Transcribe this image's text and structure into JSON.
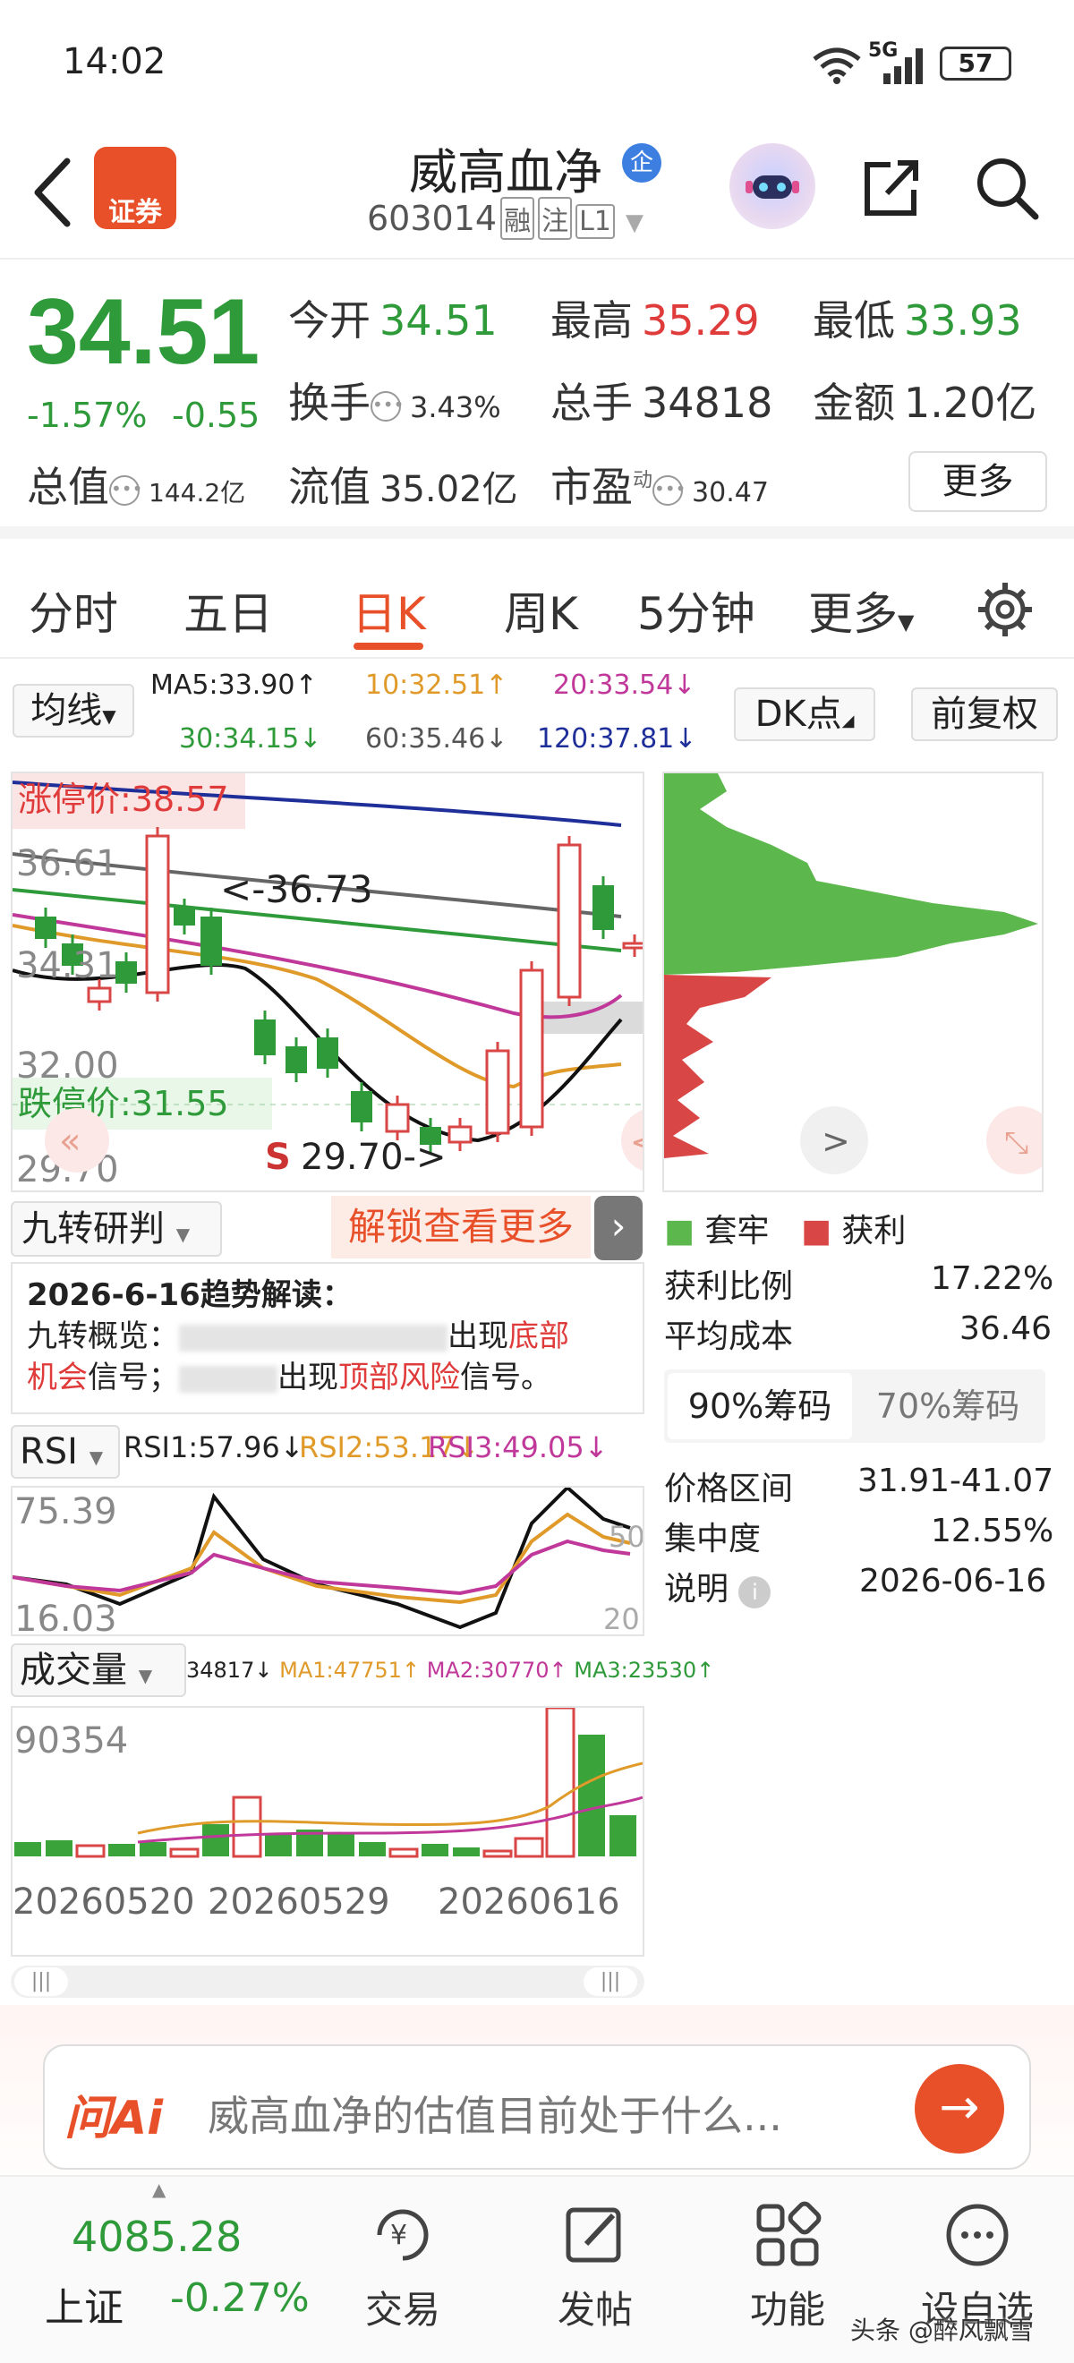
{
  "status": {
    "time": "14:02",
    "battery": "57",
    "network": "5G"
  },
  "header": {
    "app_logo": "证券",
    "name": "威高血净",
    "badge": "企",
    "code": "603014",
    "tags": [
      "融",
      "注",
      "L1"
    ]
  },
  "quote": {
    "price": "34.51",
    "pct": "-1.57%",
    "chg": "-0.55",
    "open_label": "今开",
    "open": "34.51",
    "high_label": "最高",
    "high": "35.29",
    "low_label": "最低",
    "low": "33.93",
    "turnover_label": "换手",
    "turnover": "3.43%",
    "volume_label": "总手",
    "volume": "34818",
    "amount_label": "金额",
    "amount": "1.20亿",
    "mcap_label": "总值",
    "mcap": "144.2亿",
    "float_label": "流值",
    "float": "35.02亿",
    "pe_label": "市盈",
    "pe_sup": "动",
    "pe": "30.47",
    "more": "更多"
  },
  "tabs": [
    "分时",
    "五日",
    "日K",
    "周K",
    "5分钟",
    "更多"
  ],
  "ma": {
    "select": "均线",
    "ma5": "MA5:33.90↑",
    "ma10": "10:32.51↑",
    "ma20": "20:33.54↓",
    "ma30": "30:34.15↓",
    "ma60": "60:35.46↓",
    "ma120": "120:37.81↓",
    "dk": "DK点",
    "adjust": "前复权"
  },
  "kchart": {
    "limit_up": "涨停价:38.57",
    "limit_down": "跌停价:31.55",
    "y_labels": [
      "36.61",
      "34.31",
      "32.00",
      "29.70"
    ],
    "annot_high": "<-36.73",
    "annot_low": "29.70->",
    "s_mark": "S"
  },
  "chips": {
    "legend_trap": "套牢",
    "legend_profit": "获利",
    "profit_ratio_label": "获利比例",
    "profit_ratio": "17.22%",
    "avg_cost_label": "平均成本",
    "avg_cost": "36.46",
    "tab90": "90%筹码",
    "tab70": "70%筹码",
    "range_label": "价格区间",
    "range": "31.91-41.07",
    "conc_label": "集中度",
    "conc": "12.55%",
    "note_label": "说明",
    "note": "2026-06-16"
  },
  "nine": {
    "select": "九转研判",
    "unlock": "解锁查看更多",
    "line1": "2026-6-16趋势解读：",
    "line2a": "九转概览：",
    "line2b": "出现",
    "line2c": "底部",
    "line3a": "机会",
    "line3b": "信号；",
    "line3c": "出现",
    "line3d": "顶部风险",
    "line3e": "信号。"
  },
  "rsi": {
    "select": "RSI",
    "rsi1": "RSI1:57.96↓",
    "rsi2": "RSI2:53.17↓",
    "rsi3": "RSI3:49.05↓",
    "y_top": "75.39",
    "y_bot": "16.03",
    "r50": "50",
    "r20": "20"
  },
  "vol": {
    "select": "成交量",
    "v": "34817↓",
    "ma1": "MA1:47751↑",
    "ma2": "MA2:30770↑",
    "ma3": "MA3:23530↑",
    "y_top": "90354",
    "dates": [
      "20260520",
      "20260529",
      "20260616"
    ]
  },
  "ai": {
    "logo": "问Ai",
    "prompt": "威高血净的估值目前处于什么..."
  },
  "bottom": {
    "index_value": "4085.28",
    "index_name": "上证",
    "index_pct": "-0.27%",
    "trade": "交易",
    "post": "发帖",
    "func": "功能",
    "watch": "设自选",
    "watermark": "头条 @醉风飘雪"
  },
  "colors": {
    "up": "#e03b3b",
    "down": "#2f9a3a",
    "accent": "#e8502a"
  }
}
